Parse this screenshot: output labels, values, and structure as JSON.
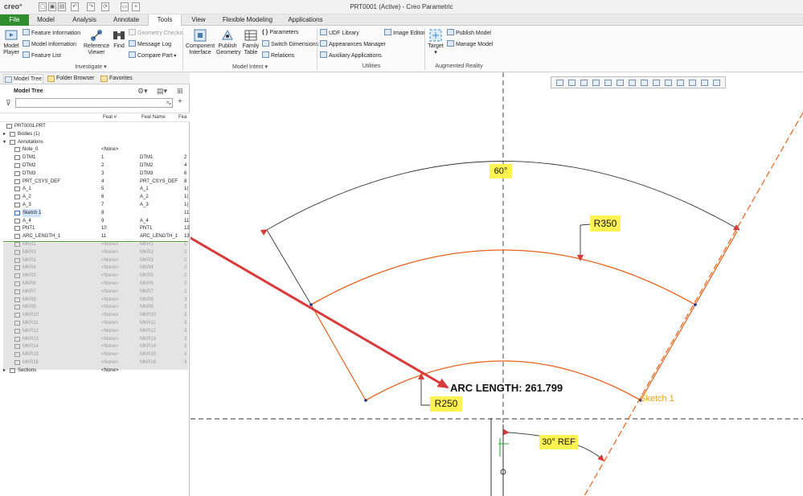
{
  "app": {
    "logo": "creo°",
    "title": "PRT0001 (Active) - Creo Parametric"
  },
  "tabs": [
    "File",
    "Model",
    "Analysis",
    "Annotate",
    "Tools",
    "View",
    "Flexible Modeling",
    "Applications"
  ],
  "active_tab": "Tools",
  "ribbon": {
    "model_player": "Model Player",
    "feature_information": "Feature Information",
    "model_information": "Model Information",
    "feature_list": "Feature List",
    "reference_viewer": "Reference Viewer",
    "find": "Find",
    "geometry_checks": "Geometry Checks",
    "message_log": "Message Log",
    "compare_part": "Compare Part",
    "investigate": "Investigate",
    "component_interface": "Component Interface",
    "publish_geometry": "Publish Geometry",
    "family_table": "Family Table",
    "parameters": "Parameters",
    "switch_dimensions": "Switch Dimensions",
    "relations": "Relations",
    "model_intent": "Model Intent",
    "udf_library": "UDF Library",
    "appearances_manager": "Appearances Manager",
    "auxiliary_applications": "Auxiliary Applications",
    "image_editor": "Image Editor",
    "utilities": "Utilities",
    "target": "Target",
    "publish_model": "Publish Model",
    "manage_model": "Manage Model",
    "augmented_reality": "Augmented Reality"
  },
  "panel": {
    "tabs": [
      "Model Tree",
      "Folder Browser",
      "Favorites"
    ],
    "title": "Model Tree",
    "columns": [
      "Feat #",
      "Feat Name",
      "Fea"
    ],
    "rows": [
      {
        "name": "PRT0001.PRT",
        "num": "",
        "feat": "",
        "extra": ""
      },
      {
        "name": "Bodies (1)",
        "num": "",
        "feat": "",
        "extra": ""
      },
      {
        "name": "Annotations",
        "num": "",
        "feat": "",
        "extra": ""
      },
      {
        "name": "Note_0",
        "num": "<None>",
        "feat": "",
        "extra": ""
      },
      {
        "name": "DTM1",
        "num": "1",
        "feat": "DTM1",
        "extra": "2"
      },
      {
        "name": "DTM2",
        "num": "2",
        "feat": "DTM2",
        "extra": "4"
      },
      {
        "name": "DTM3",
        "num": "3",
        "feat": "DTM3",
        "extra": "6"
      },
      {
        "name": "PRT_CSYS_DEF",
        "num": "4",
        "feat": "PRT_CSYS_DEF",
        "extra": "8"
      },
      {
        "name": "A_1",
        "num": "5",
        "feat": "A_1",
        "extra": "1("
      },
      {
        "name": "A_2",
        "num": "6",
        "feat": "A_2",
        "extra": "1("
      },
      {
        "name": "A_3",
        "num": "7",
        "feat": "A_3",
        "extra": "1("
      },
      {
        "name": "Sketch 1",
        "num": "8",
        "feat": "",
        "extra": "11"
      },
      {
        "name": "A_4",
        "num": "9",
        "feat": "A_4",
        "extra": "11"
      },
      {
        "name": "PNT1",
        "num": "10",
        "feat": "PNT1",
        "extra": "12"
      },
      {
        "name": "ARC_LENGTH_1",
        "num": "11",
        "feat": "ARC_LENGTH_1",
        "extra": "13"
      },
      {
        "name": "MKR1",
        "num": "<None>",
        "feat": "MKR1",
        "extra": "1"
      },
      {
        "name": "MKR2",
        "num": "<None>",
        "feat": "MKR2",
        "extra": "2"
      },
      {
        "name": "MKR3",
        "num": "<None>",
        "feat": "MKR3",
        "extra": "2"
      },
      {
        "name": "MKR4",
        "num": "<None>",
        "feat": "MKR4",
        "extra": "2"
      },
      {
        "name": "MKR5",
        "num": "<None>",
        "feat": "MKR5",
        "extra": "2"
      },
      {
        "name": "MKR6",
        "num": "<None>",
        "feat": "MKR6",
        "extra": "2"
      },
      {
        "name": "MKR7",
        "num": "<None>",
        "feat": "MKR7",
        "extra": "2"
      },
      {
        "name": "MKR8",
        "num": "<None>",
        "feat": "MKR8",
        "extra": "3"
      },
      {
        "name": "MKR9",
        "num": "<None>",
        "feat": "MKR9",
        "extra": "3"
      },
      {
        "name": "MKR10",
        "num": "<None>",
        "feat": "MKR10",
        "extra": "3"
      },
      {
        "name": "MKR11",
        "num": "<None>",
        "feat": "MKR11",
        "extra": "3"
      },
      {
        "name": "MKR12",
        "num": "<None>",
        "feat": "MKR12",
        "extra": "3"
      },
      {
        "name": "MKR13",
        "num": "<None>",
        "feat": "MKR13",
        "extra": "3"
      },
      {
        "name": "MKR14",
        "num": "<None>",
        "feat": "MKR14",
        "extra": "3"
      },
      {
        "name": "MKR15",
        "num": "<None>",
        "feat": "MKR15",
        "extra": "3"
      },
      {
        "name": "MKR16",
        "num": "<None>",
        "feat": "MKR16",
        "extra": "3"
      },
      {
        "name": "Sections",
        "num": "<None>",
        "feat": "",
        "extra": ""
      }
    ]
  },
  "canvas": {
    "dim_angle": "60°",
    "dim_r350": "R350",
    "dim_r250": "R250",
    "arc_length": "ARC LENGTH: 261.799",
    "sketch_label": "Sketch 1",
    "ref_angle": "30° REF"
  },
  "colors": {
    "file_tab": "#2f8d2f",
    "sketch_orange": "#e8611a",
    "highlight": "#fff352",
    "annotation_arrow": "#d93a3a"
  }
}
